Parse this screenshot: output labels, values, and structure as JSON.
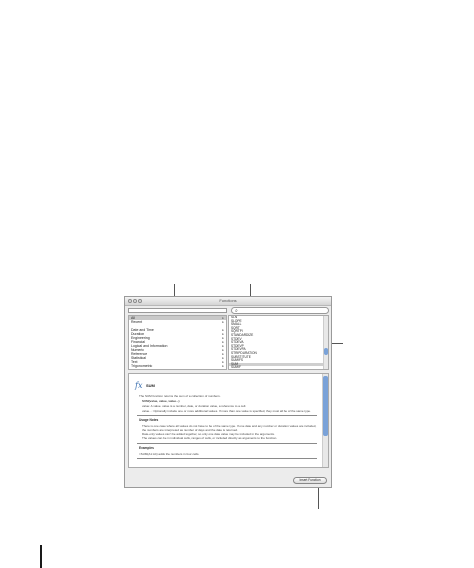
{
  "window": {
    "title": "Functions"
  },
  "search": {
    "placeholder": ""
  },
  "categories": {
    "items": [
      {
        "label": "All",
        "selected": true
      },
      {
        "label": "Recent",
        "selected": false
      },
      {
        "label": "Date and Time",
        "selected": false
      },
      {
        "label": "Duration",
        "selected": false
      },
      {
        "label": "Engineering",
        "selected": false
      },
      {
        "label": "Financial",
        "selected": false
      },
      {
        "label": "Logical and Information",
        "selected": false
      },
      {
        "label": "Numeric",
        "selected": false
      },
      {
        "label": "Reference",
        "selected": false
      },
      {
        "label": "Statistical",
        "selected": false
      },
      {
        "label": "Text",
        "selected": false
      },
      {
        "label": "Trigonometric",
        "selected": false
      }
    ]
  },
  "functions": {
    "items": [
      {
        "label": "SLN",
        "selected": false
      },
      {
        "label": "SLOPE",
        "selected": false
      },
      {
        "label": "SMALL",
        "selected": false
      },
      {
        "label": "SQRT",
        "selected": false
      },
      {
        "label": "SQRTPI",
        "selected": false
      },
      {
        "label": "STANDARDIZE",
        "selected": false
      },
      {
        "label": "STDEV",
        "selected": false
      },
      {
        "label": "STDEVA",
        "selected": false
      },
      {
        "label": "STDEVP",
        "selected": false
      },
      {
        "label": "STDEVPA",
        "selected": false
      },
      {
        "label": "STRIPDURATION",
        "selected": false
      },
      {
        "label": "SUBSTITUTE",
        "selected": false
      },
      {
        "label": "SUMIFS",
        "selected": false
      },
      {
        "label": "SUM",
        "selected": true
      },
      {
        "label": "SUMIF",
        "selected": false
      },
      {
        "label": "SUMIFS",
        "selected": false
      }
    ]
  },
  "description": {
    "name": "SUM",
    "summary": "The SUM function returns the sum of a collection of numbers.",
    "syntax": "SUM(value, value, value...)",
    "args": [
      "value: A value. value is a number, date, or duration value, a reference to a cell.",
      "value...: Optionally include one or more additional values. If more than one value is specified, they must all be of the same type."
    ],
    "usage_heading": "Usage Notes",
    "notes": [
      "There is one case where all values do not have to be of the same type. If one date and any number or duration values are included,",
      "the numbers are interpreted as number of days and the date is returned.",
      "Date-only values can't be added together, so only one date value may be included in the arguments.",
      "The values can be in individual cells, ranges of cells, or included directly as arguments to the function."
    ],
    "examples_heading": "Examples",
    "example": "=SUM(A1:A4) adds the numbers in four cells."
  },
  "buttons": {
    "insert": "Insert Function"
  }
}
